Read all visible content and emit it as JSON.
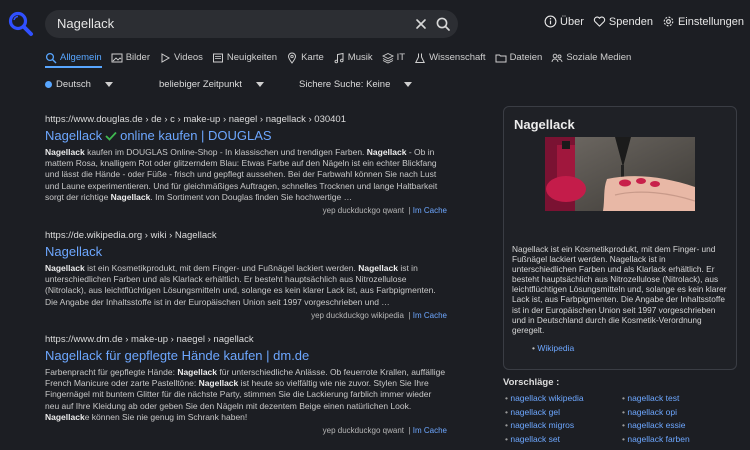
{
  "search": {
    "query": "Nagellack"
  },
  "top_links": {
    "about": "Über",
    "donate": "Spenden",
    "settings": "Einstellungen"
  },
  "tabs": [
    {
      "label": "Allgemein",
      "icon": "search-icon"
    },
    {
      "label": "Bilder",
      "icon": "image-icon"
    },
    {
      "label": "Videos",
      "icon": "play-icon"
    },
    {
      "label": "Neuigkeiten",
      "icon": "newspaper-icon"
    },
    {
      "label": "Karte",
      "icon": "map-pin-icon"
    },
    {
      "label": "Musik",
      "icon": "music-icon"
    },
    {
      "label": "IT",
      "icon": "layers-icon"
    },
    {
      "label": "Wissenschaft",
      "icon": "flask-icon"
    },
    {
      "label": "Dateien",
      "icon": "folder-icon"
    },
    {
      "label": "Soziale Medien",
      "icon": "users-icon"
    }
  ],
  "filters": {
    "language": "Deutsch",
    "time": "beliebiger Zeitpunkt",
    "safe": "Sichere Suche: Keine"
  },
  "results": [
    {
      "url": "https://www.douglas.de  › de › c › make-up › naegel › nagellack › 030401",
      "title_pre": "Nagellack",
      "title_post": "online kaufen | DOUGLAS",
      "snippet": [
        {
          "b": "Nagellack"
        },
        {
          "t": " kaufen im DOUGLAS Online-Shop - In klassischen und trendigen Farben. "
        },
        {
          "b": "Nagellack"
        },
        {
          "t": " - Ob in mattem Rosa, knalligem Rot oder glitzerndem Blau: Etwas Farbe auf den Nägeln ist ein echter Blickfang und lässt die Hände - oder Füße - frisch und gepflegt aussehen. Bei der Farbwahl können Sie nach Lust und Laune experimentieren. Und für gleichmäßiges Auftragen, schnelles Trocknen und lange Haltbarkeit sorgt der richtige "
        },
        {
          "b": "Nagellack"
        },
        {
          "t": ". Im Sortiment von Douglas finden Sie hochwertige …"
        }
      ],
      "engines": "yep  duckduckgo  qwant",
      "cache": "Im Cache"
    },
    {
      "url": "https://de.wikipedia.org  › wiki › Nagellack",
      "title_pre": "Nagellack",
      "title_post": "",
      "snippet": [
        {
          "b": "Nagellack"
        },
        {
          "t": " ist ein Kosmetikprodukt, mit dem Finger- und Fußnägel lackiert werden. "
        },
        {
          "b": "Nagellack"
        },
        {
          "t": " ist in unterschiedlichen Farben und als Klarlack erhältlich. Er besteht hauptsächlich aus Nitrozellulose (Nitrolack), aus leichtflüchtigen Lösungsmitteln und, solange es kein klarer Lack ist, aus Farbpigmenten. Die Angabe der Inhaltsstoffe ist in der Europäischen Union seit 1997 vorgeschrieben und …"
        }
      ],
      "engines": "yep  duckduckgo  wikipedia",
      "cache": "Im Cache"
    },
    {
      "url": "https://www.dm.de  › make-up › naegel › nagellack",
      "title_pre": "Nagellack für gepflegte Hände kaufen | dm.de",
      "title_post": "",
      "snippet": [
        {
          "t": "Farbenpracht für gepflegte Hände: "
        },
        {
          "b": "Nagellack"
        },
        {
          "t": " für unterschiedliche Anlässe. Ob feuerrote Krallen, auffällige French Manicure oder zarte Pastelltöne: "
        },
        {
          "b": "Nagellack"
        },
        {
          "t": " ist heute so vielfältig wie nie zuvor. Stylen Sie Ihre Fingernägel mit buntem Glitter für die nächste Party, stimmen Sie die Lackierung farblich immer wieder neu auf Ihre Kleidung ab oder geben Sie den Nägeln mit dezentem Beige einen natürlichen Look. "
        },
        {
          "b": "Nagellack"
        },
        {
          "t": "e können Sie nie genug im Schrank haben!"
        }
      ],
      "engines": "yep  duckduckgo  qwant",
      "cache": "Im Cache"
    }
  ],
  "infobox": {
    "title": "Nagellack",
    "text": "Nagellack ist ein Kosmetikprodukt, mit dem Finger- und Fußnägel lackiert werden. Nagellack ist in unterschiedlichen Farben und als Klarlack erhältlich. Er besteht hauptsächlich aus Nitrozellulose (Nitrolack), aus leichtflüchtigen Lösungsmitteln und, solange es kein klarer Lack ist, aus Farbpigmenten. Die Angabe der Inhaltsstoffe ist in der Europäischen Union seit 1997 vorgeschrieben und in Deutschland durch die Kosmetik-Verordnung geregelt.",
    "link": "Wikipedia"
  },
  "suggestions": {
    "title": "Vorschläge :",
    "items": [
      "nagellack wikipedia",
      "nagellack test",
      "nagellack gel",
      "nagellack opi",
      "nagellack migros",
      "nagellack essie",
      "nagellack set",
      "nagellack farben"
    ]
  },
  "colors": {
    "background": "#1c1e23",
    "accent": "#58a6ff",
    "link": "#6da7ff",
    "check": "#3fb950"
  }
}
